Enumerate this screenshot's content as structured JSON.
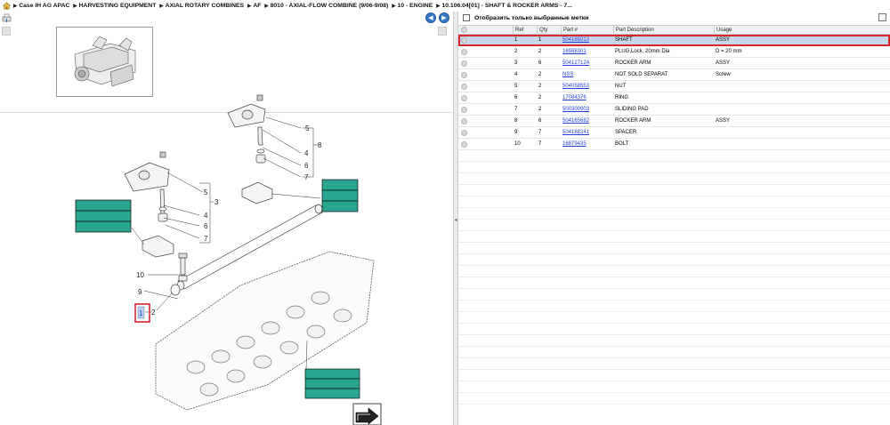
{
  "breadcrumb": [
    "Case IH AG APAC",
    "HARVESTING EQUIPMENT",
    "AXIAL ROTARY COMBINES",
    "AF",
    "8010 - AXIAL-FLOW COMBINE (9/06-9/08)",
    "10 - ENGINE",
    "10.106.04[01] - SHAFT & ROCKER ARMS - 7..."
  ],
  "filter": {
    "label": "Отобразить только выбранные метки",
    "checked": false
  },
  "table": {
    "columns": [
      "",
      "Ref",
      "Qty",
      "Part #",
      "Part Description",
      "Usage"
    ],
    "rows": [
      {
        "ref": "1",
        "qty": "1",
        "part": "504189213",
        "desc": "SHAFT",
        "usage": "ASSY",
        "selected": true
      },
      {
        "ref": "2",
        "qty": "2",
        "part": "16988301",
        "desc": "PLUG,Lock, 20mm Dia",
        "usage": "D = 20 mm"
      },
      {
        "ref": "3",
        "qty": "6",
        "part": "504127124",
        "desc": "ROCKER ARM",
        "usage": "ASSY"
      },
      {
        "ref": "4",
        "qty": "2",
        "part": "NSS",
        "desc": "NOT SOLD SEPARAT",
        "usage": "Screw"
      },
      {
        "ref": "5",
        "qty": "2",
        "part": "504058553",
        "desc": "NUT",
        "usage": ""
      },
      {
        "ref": "6",
        "qty": "2",
        "part": "17084376",
        "desc": "RING",
        "usage": ""
      },
      {
        "ref": "7",
        "qty": "2",
        "part": "500300903",
        "desc": "SLIDING PAD",
        "usage": ""
      },
      {
        "ref": "8",
        "qty": "6",
        "part": "504165682",
        "desc": "ROCKER ARM",
        "usage": "ASSY"
      },
      {
        "ref": "9",
        "qty": "7",
        "part": "504188241",
        "desc": "SPACER",
        "usage": ""
      },
      {
        "ref": "10",
        "qty": "7",
        "part": "16879435",
        "desc": "BOLT",
        "usage": ""
      }
    ]
  },
  "diagram": {
    "callouts": [
      "5",
      "8",
      "4",
      "6",
      "7",
      "5",
      "3",
      "4",
      "6",
      "7",
      "10",
      "9",
      "1",
      "2"
    ],
    "selected_callout": "1"
  },
  "colors": {
    "accent": "#3a78c7",
    "selection_border": "#d9262b",
    "label_green": "#2aa58f",
    "link": "#1f3fd6"
  },
  "icons": {
    "home": "home-icon",
    "back": "back-arrow-icon",
    "forward": "forward-arrow-icon",
    "export": "export-arrow-icon"
  }
}
